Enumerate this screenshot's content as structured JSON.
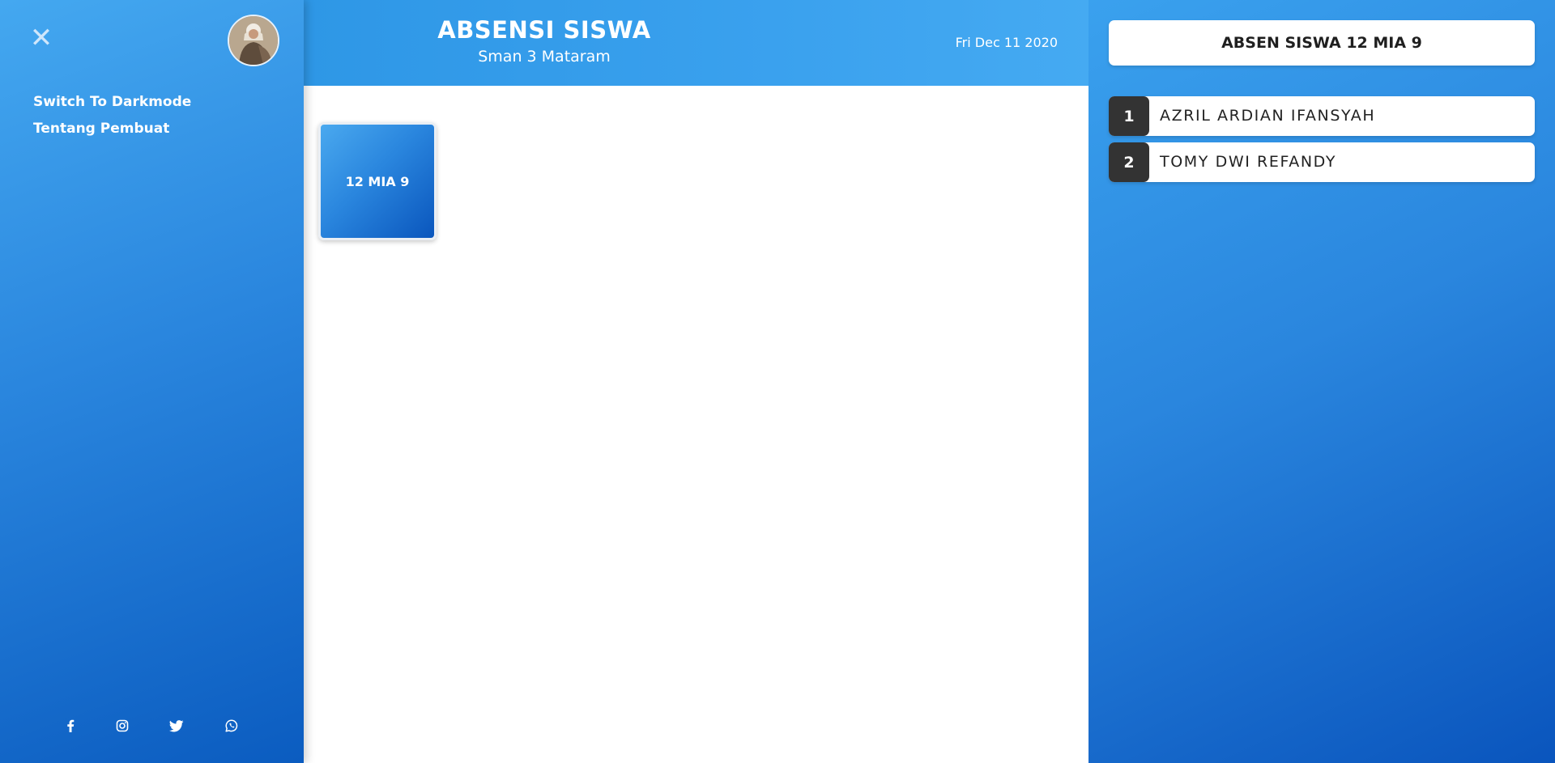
{
  "sidebar": {
    "close_icon": "close-icon",
    "avatar_icon": "user-avatar",
    "links": [
      {
        "label": "Switch To Darkmode"
      },
      {
        "label": "Tentang Pembuat"
      }
    ],
    "social_icons": [
      "facebook-icon",
      "instagram-icon",
      "twitter-icon",
      "whatsapp-icon"
    ]
  },
  "header": {
    "title": "ABSENSI SISWA",
    "subtitle": "Sman 3 Mataram",
    "date": "Fri Dec 11 2020"
  },
  "main": {
    "classes": [
      {
        "label": "12 MIA 9"
      }
    ]
  },
  "panel": {
    "title": "ABSEN SISWA 12 MIA 9",
    "students": [
      {
        "number": "1",
        "name": "AZRIL ARDIAN IFANSYAH"
      },
      {
        "number": "2",
        "name": "TOMY DWI REFANDY"
      }
    ]
  },
  "colors": {
    "accent_blue": "#2a86de",
    "dark_blue": "#0b5cc0",
    "number_badge": "#333333",
    "text_dark": "#222222"
  }
}
